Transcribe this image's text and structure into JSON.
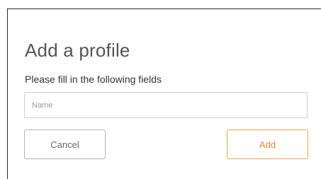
{
  "dialog": {
    "title": "Add a profile",
    "subtitle": "Please fill in the following fields",
    "name_field": {
      "placeholder": "Name",
      "value": ""
    },
    "cancel_label": "Cancel",
    "add_label": "Add"
  },
  "colors": {
    "accent": "#e8892a",
    "accent_border": "#f0a24a",
    "title_text": "#555555",
    "frame_line": "#2a2a2a"
  }
}
